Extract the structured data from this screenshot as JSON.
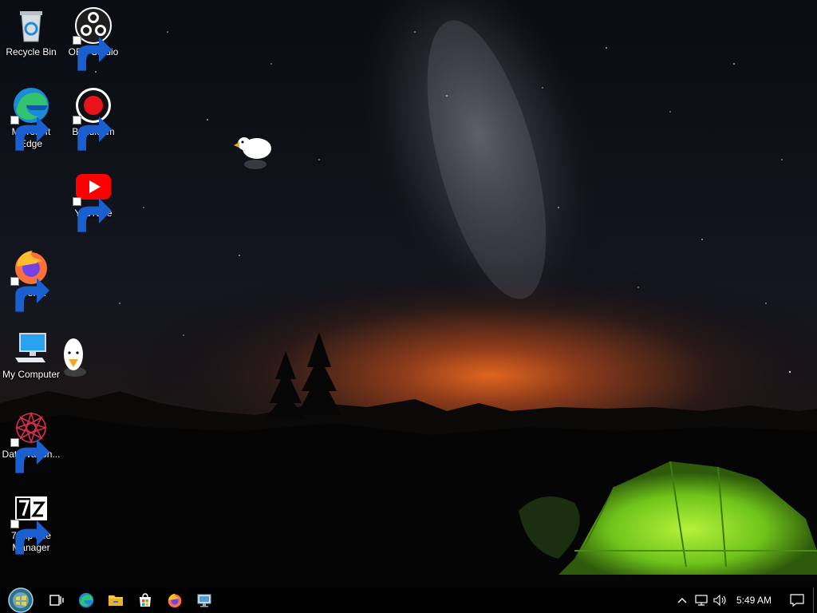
{
  "desktop": {
    "icons": [
      {
        "id": "recycle-bin",
        "label": "Recycle Bin",
        "icon": "recycle-bin-icon",
        "shortcut": false
      },
      {
        "id": "obs-studio",
        "label": "OBS Studio",
        "icon": "obs-studio-icon",
        "shortcut": true
      },
      {
        "id": "microsoft-edge",
        "label": "Microsoft Edge",
        "icon": "edge-icon",
        "shortcut": true
      },
      {
        "id": "bandicam",
        "label": "Bandicam",
        "icon": "bandicam-icon",
        "shortcut": true
      },
      {
        "id": "youtube",
        "label": "YouTube",
        "icon": "youtube-icon",
        "shortcut": true
      },
      {
        "id": "firefox",
        "label": "Firefox",
        "icon": "firefox-icon",
        "shortcut": true
      },
      {
        "id": "my-computer",
        "label": "My Computer",
        "icon": "computer-icon",
        "shortcut": false
      },
      {
        "id": "datawagon",
        "label": "DataWagon...",
        "icon": "datawagon-icon",
        "shortcut": true
      },
      {
        "id": "seven-zip",
        "label": "7-Zip File Manager",
        "icon": "seven-zip-icon",
        "shortcut": true
      }
    ],
    "overlays": [
      "duck-icon",
      "duck-icon"
    ]
  },
  "taskbar": {
    "start": "start-orb-icon",
    "pinned": [
      "task-view-icon",
      "edge-icon",
      "file-explorer-icon",
      "store-icon",
      "firefox-icon",
      "remote-desktop-icon"
    ],
    "tray_icons": [
      "chevron-up-icon",
      "network-icon",
      "volume-icon"
    ],
    "clock": "5:49 AM",
    "notification": "action-center-icon"
  },
  "colors": {
    "taskbar": "#000000",
    "tent": "#7ed321",
    "horizon_glow": "#d0571e",
    "youtube_red": "#ff0000"
  }
}
